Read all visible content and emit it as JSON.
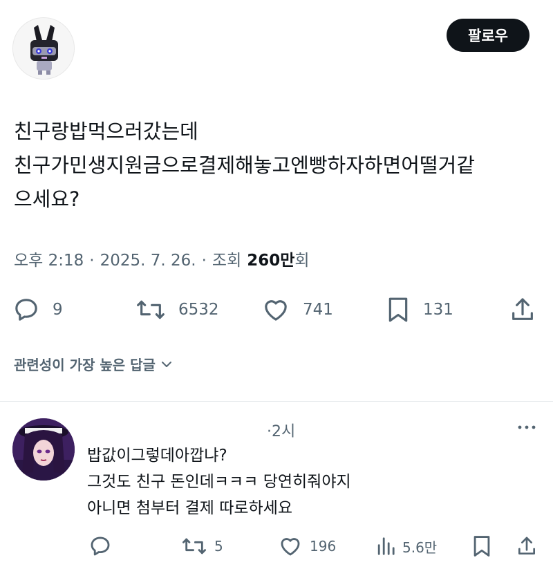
{
  "post": {
    "follow_label": "팔로우",
    "text_lines": [
      "친구랑밥먹으러갔는데",
      "친구가민생지원금으로결제해놓고엔빵하자하면어떨거같",
      "으세요?"
    ],
    "time": "오후 2:18",
    "date": "2025. 7. 26.",
    "views_label": "조회",
    "views_count": "260만",
    "views_suffix": "회",
    "separator": "·",
    "actions": {
      "replies": "9",
      "reposts": "6532",
      "likes": "741",
      "bookmarks": "131"
    }
  },
  "sort": {
    "label": "관련성이 가장 높은 답글"
  },
  "reply": {
    "time": "·2시",
    "text_lines": [
      "밥값이그렇데아깝냐?",
      "그것도 친구 돈인데ㅋㅋㅋ 당연히줘야지",
      "아니면 첨부터 결제 따로하세요"
    ],
    "actions": {
      "reposts": "5",
      "likes": "196",
      "views": "5.6만"
    }
  },
  "colors": {
    "text": "#0f1419",
    "secondary": "#536471",
    "button_bg": "#0f1419"
  },
  "icons": [
    "reply-icon",
    "repost-icon",
    "like-icon",
    "bookmark-icon",
    "share-icon",
    "views-icon",
    "more-icon",
    "chevron-down-icon"
  ]
}
